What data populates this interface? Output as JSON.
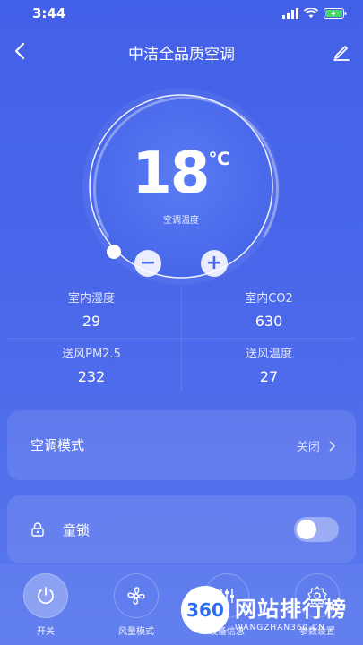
{
  "status_bar": {
    "time": "3:44"
  },
  "header": {
    "title": "中洁全品质空调"
  },
  "dial": {
    "temperature": "18",
    "unit": "℃",
    "label": "空调温度",
    "minus_label": "−",
    "plus_label": "+"
  },
  "stats": [
    {
      "label": "室内湿度",
      "value": "29"
    },
    {
      "label": "室内CO2",
      "value": "630"
    },
    {
      "label": "送风PM2.5",
      "value": "232"
    },
    {
      "label": "送风温度",
      "value": "27"
    }
  ],
  "mode_card": {
    "label": "空调模式",
    "value": "关闭"
  },
  "lock_card": {
    "label": "童锁",
    "toggle_on": false
  },
  "bottom_nav": [
    {
      "label": "开关",
      "icon": "power-icon"
    },
    {
      "label": "风量模式",
      "icon": "fan-icon"
    },
    {
      "label": "设备信息",
      "icon": "sliders-icon"
    },
    {
      "label": "参数设置",
      "icon": "gear-icon"
    }
  ],
  "watermark": {
    "badge": "360",
    "text": "网站排行榜",
    "sub": "WANGZHAN360.CN"
  },
  "colors": {
    "background": "#4a67ea",
    "accent": "#ffffff"
  }
}
